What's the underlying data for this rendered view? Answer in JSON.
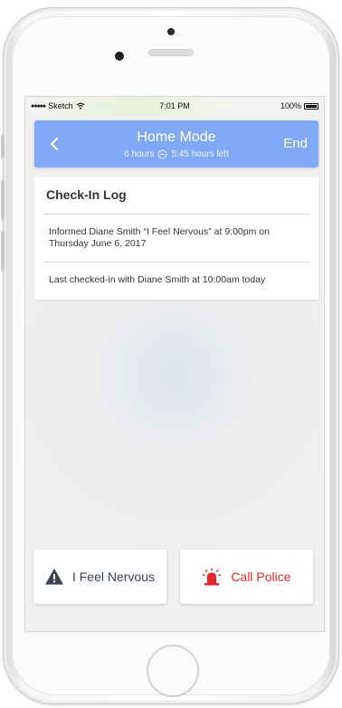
{
  "status_bar": {
    "carrier": "Sketch",
    "time": "7:01 PM",
    "battery": "100%"
  },
  "header": {
    "title": "Home Mode",
    "subtitle_duration": "6 hours",
    "subtitle_remaining": "5:45 hours left",
    "end_label": "End",
    "color": "#7fa8f5"
  },
  "check_in_log": {
    "title": "Check-In Log",
    "entries": [
      "Informed Diane Smith “I Feel Nervous” at 9:00pm on Thursday June 6, 2017",
      "Last checked-in with Diane Smith at 10:00am today"
    ]
  },
  "actions": {
    "nervous_label": "I Feel Nervous",
    "nervous_icon": "warning-icon",
    "police_label": "Call Police",
    "police_icon": "siren-icon",
    "police_color": "#e4262d"
  }
}
